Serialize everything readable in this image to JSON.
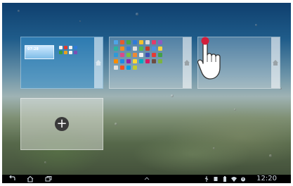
{
  "home_screens": {
    "panes": [
      {
        "id": "pane-1",
        "state": "active",
        "widget_time": "07:28",
        "icon": "home-icon"
      },
      {
        "id": "pane-2",
        "state": "inactive",
        "icon": "home-icon"
      },
      {
        "id": "pane-3",
        "state": "empty-touched",
        "icon": "home-icon"
      }
    ],
    "add_pane": {
      "icon": "plus-icon",
      "glyph": "+"
    }
  },
  "navbar": {
    "buttons": [
      {
        "name": "back-button",
        "icon": "back-arrow-icon"
      },
      {
        "name": "home-button",
        "icon": "home-outline-icon"
      },
      {
        "name": "recent-apps-button",
        "icon": "recent-apps-icon"
      }
    ],
    "center_handle": "chevron-up-icon",
    "status_icons": [
      "usb-icon",
      "sd-card-icon",
      "battery-icon",
      "wifi-icon",
      "alarm-icon"
    ],
    "clock": "12:20"
  },
  "colors": {
    "accent": "#3c96d2",
    "navbar": "#000000",
    "touch_dot": "#d21f3c"
  }
}
